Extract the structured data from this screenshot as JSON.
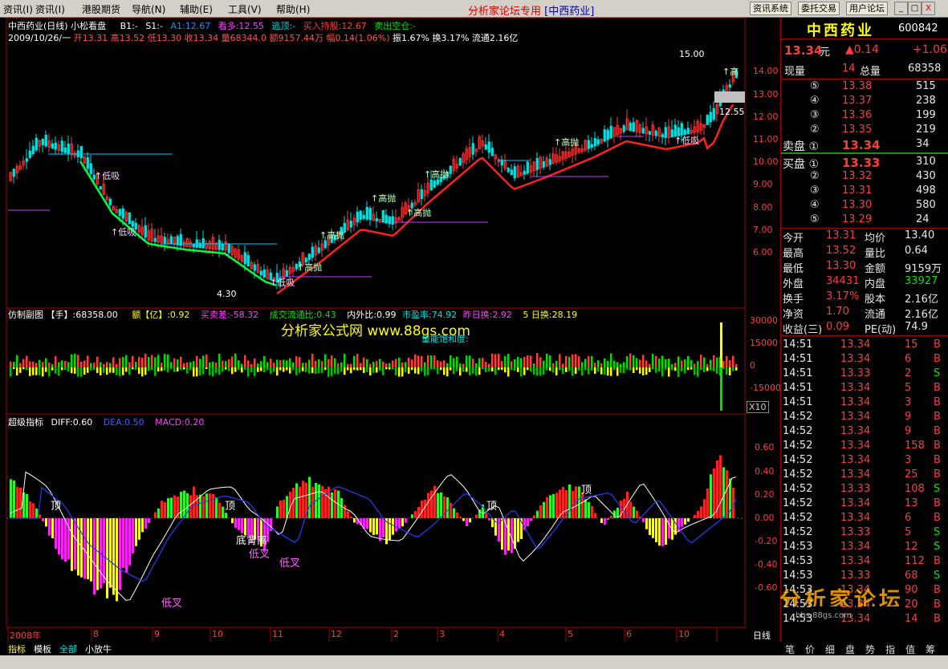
{
  "menu": {
    "items": [
      "资讯(I)",
      "港股期货",
      "导航(N)",
      "辅助(E)",
      "工具(V)",
      "帮助(H)"
    ],
    "center_title": "分析家论坛专用",
    "center_stock": "[中西药业]",
    "buttons": [
      "资讯系统",
      "委托交易",
      "用户论坛"
    ],
    "window_icons": [
      "_",
      "□",
      "X"
    ]
  },
  "chart_header": {
    "line1": "中西药业(日线) 小松看盘",
    "b1": "B1:-",
    "s1": "S1:-",
    "a1": "A1:12.67",
    "kanduo": "看多:12.55",
    "taoding": "逃顶:-",
    "mairu": "买入持股:12.67",
    "maichu": "卖出空仓:-",
    "line2_date": "2009/10/26/一",
    "line2_ohlc": "开13.31 高13.52 低13.30 收13.34 量68344.0 额9157.44万 幅0.14(1.06%)",
    "line2_tail": "振1.67% 换3.17% 流通2.16亿"
  },
  "main_axis": [
    "14.00",
    "13.00",
    "12.00",
    "11.00",
    "10.00",
    "9.00",
    "8.00",
    "7.00",
    "6.00"
  ],
  "price_labels": {
    "high": "15.00",
    "low": "4.30",
    "last": "12.55"
  },
  "signals": [
    "低吸",
    "低吸",
    "低吸",
    "高抛",
    "高抛",
    "高抛",
    "高抛",
    "高抛",
    "高抛",
    "低吸",
    "高"
  ],
  "sub1": {
    "title": "仿制副图 【手】:68358.00",
    "amt": "额【亿】:0.92",
    "diff": "买卖差:-58.32",
    "ratio": "成交流通比:0.43",
    "inout": "内外比:0.99",
    "pe": "市盈率:74.92",
    "yest": "昨日换:2.92",
    "fiveday": "5 日换:28.19",
    "watermark": "分析家公式网 www.88gs.com",
    "sublabel": "量能饱和度:",
    "axis": [
      "30000",
      "15000",
      "0",
      "-15000"
    ],
    "scale": "X10"
  },
  "sub2": {
    "title": "超级指标",
    "diff": "DIFF:0.60",
    "dea": "DEA:0.50",
    "macd": "MACD:0.20",
    "axis": [
      "0.60",
      "0.40",
      "0.20",
      "0.00",
      "-0.20",
      "-0.40",
      "-0.60"
    ],
    "labels": [
      "顶",
      "顶",
      "顶",
      "顶",
      "底背离",
      "低叉",
      "低叉",
      "低叉"
    ]
  },
  "x_axis": [
    "2008年",
    "8",
    "9",
    "10",
    "11",
    "12",
    "2",
    "3",
    "4",
    "5",
    "6",
    "10"
  ],
  "bottom_tabs": [
    "指标",
    "模板",
    "全部",
    "小放牛"
  ],
  "period_label": "日线",
  "quote": {
    "name": "中西药业",
    "code": "600842",
    "price": "13.34",
    "unit": "元",
    "change": "▲0.14",
    "change2": "+1.06",
    "xianliang_label": "现量",
    "xianliang": "14",
    "zongliang_label": "总量",
    "zongliang": "68358",
    "sell": [
      {
        "lvl": "⑤",
        "price": "13.38",
        "vol": "515"
      },
      {
        "lvl": "④",
        "price": "13.37",
        "vol": "238"
      },
      {
        "lvl": "③",
        "price": "13.36",
        "vol": "199"
      },
      {
        "lvl": "②",
        "price": "13.35",
        "vol": "219"
      },
      {
        "lvl": "卖盘 ①",
        "price": "13.34",
        "vol": "34"
      }
    ],
    "buy": [
      {
        "lvl": "买盘 ①",
        "price": "13.33",
        "vol": "310"
      },
      {
        "lvl": "②",
        "price": "13.32",
        "vol": "430"
      },
      {
        "lvl": "③",
        "price": "13.31",
        "vol": "498"
      },
      {
        "lvl": "④",
        "price": "13.30",
        "vol": "580"
      },
      {
        "lvl": "⑤",
        "price": "13.29",
        "vol": "24"
      }
    ],
    "stats": [
      [
        "今开",
        "13.31",
        "均价",
        "13.40"
      ],
      [
        "最高",
        "13.52",
        "量比",
        "0.64"
      ],
      [
        "最低",
        "13.30",
        "金额",
        "9159万"
      ],
      [
        "外盘",
        "34431",
        "内盘",
        "33927"
      ],
      [
        "换手",
        "3.17%",
        "股本",
        "2.16亿"
      ],
      [
        "净资",
        "1.70",
        "流通",
        "2.16亿"
      ],
      [
        "收益(三)",
        "0.09",
        "PE(动)",
        "74.9"
      ]
    ],
    "ticks": [
      [
        "14:51",
        "13.34",
        "15",
        "B"
      ],
      [
        "14:51",
        "13.34",
        "6",
        "B"
      ],
      [
        "14:51",
        "13.33",
        "2",
        "S"
      ],
      [
        "14:51",
        "13.34",
        "5",
        "B"
      ],
      [
        "14:51",
        "13.34",
        "3",
        "B"
      ],
      [
        "14:52",
        "13.34",
        "9",
        "B"
      ],
      [
        "14:52",
        "13.34",
        "9",
        "B"
      ],
      [
        "14:52",
        "13.34",
        "158",
        "B"
      ],
      [
        "14:52",
        "13.34",
        "3",
        "B"
      ],
      [
        "14:52",
        "13.34",
        "25",
        "B"
      ],
      [
        "14:52",
        "13.33",
        "108",
        "S"
      ],
      [
        "14:52",
        "13.34",
        "13",
        "B"
      ],
      [
        "14:52",
        "13.34",
        "6",
        "B"
      ],
      [
        "14:52",
        "13.33",
        "5",
        "S"
      ],
      [
        "14:53",
        "13.34",
        "12",
        "S"
      ],
      [
        "14:53",
        "13.34",
        "112",
        "B"
      ],
      [
        "14:53",
        "13.33",
        "68",
        "S"
      ],
      [
        "14:53",
        "13.34",
        "90",
        "B"
      ],
      [
        "14:53",
        "13.34",
        "20",
        "B"
      ],
      [
        "14:53",
        "13.34",
        "14",
        "B"
      ]
    ],
    "watermark": "分析家论坛",
    "watermark_url": "bbs.88gs.com"
  },
  "right_tabs": [
    "笔",
    "价",
    "细",
    "盘",
    "势",
    "指",
    "值",
    "筹"
  ]
}
